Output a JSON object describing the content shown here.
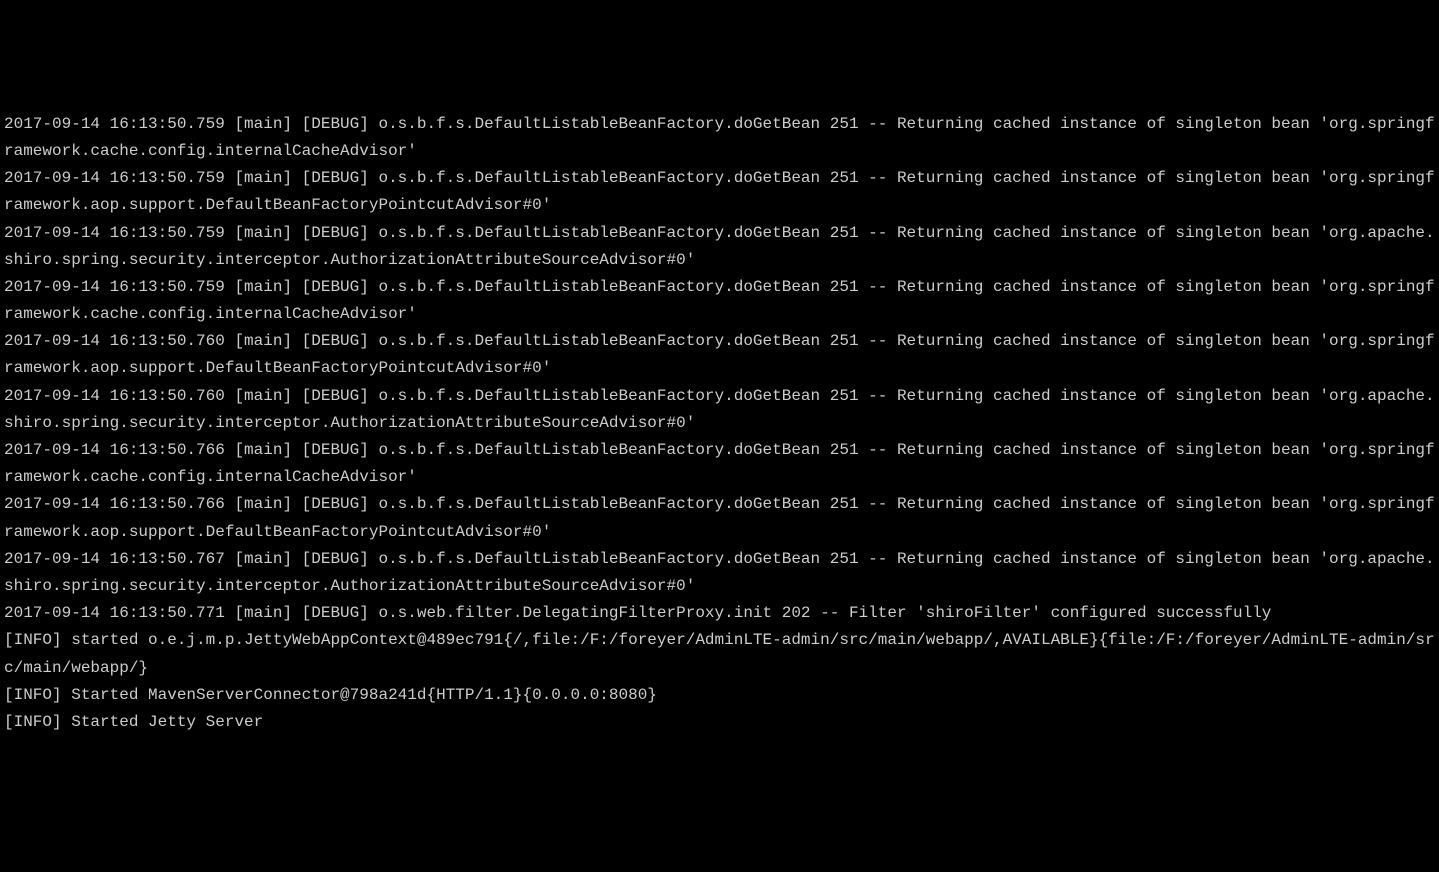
{
  "log_lines": [
    "2017-09-14 16:13:50.759 [main] [DEBUG] o.s.b.f.s.DefaultListableBeanFactory.doGetBean 251 -- Returning cached instance of singleton bean 'org.springframework.cache.config.internalCacheAdvisor'",
    "2017-09-14 16:13:50.759 [main] [DEBUG] o.s.b.f.s.DefaultListableBeanFactory.doGetBean 251 -- Returning cached instance of singleton bean 'org.springframework.aop.support.DefaultBeanFactoryPointcutAdvisor#0'",
    "2017-09-14 16:13:50.759 [main] [DEBUG] o.s.b.f.s.DefaultListableBeanFactory.doGetBean 251 -- Returning cached instance of singleton bean 'org.apache.shiro.spring.security.interceptor.AuthorizationAttributeSourceAdvisor#0'",
    "2017-09-14 16:13:50.759 [main] [DEBUG] o.s.b.f.s.DefaultListableBeanFactory.doGetBean 251 -- Returning cached instance of singleton bean 'org.springframework.cache.config.internalCacheAdvisor'",
    "2017-09-14 16:13:50.760 [main] [DEBUG] o.s.b.f.s.DefaultListableBeanFactory.doGetBean 251 -- Returning cached instance of singleton bean 'org.springframework.aop.support.DefaultBeanFactoryPointcutAdvisor#0'",
    "2017-09-14 16:13:50.760 [main] [DEBUG] o.s.b.f.s.DefaultListableBeanFactory.doGetBean 251 -- Returning cached instance of singleton bean 'org.apache.shiro.spring.security.interceptor.AuthorizationAttributeSourceAdvisor#0'",
    "2017-09-14 16:13:50.766 [main] [DEBUG] o.s.b.f.s.DefaultListableBeanFactory.doGetBean 251 -- Returning cached instance of singleton bean 'org.springframework.cache.config.internalCacheAdvisor'",
    "2017-09-14 16:13:50.766 [main] [DEBUG] o.s.b.f.s.DefaultListableBeanFactory.doGetBean 251 -- Returning cached instance of singleton bean 'org.springframework.aop.support.DefaultBeanFactoryPointcutAdvisor#0'",
    "2017-09-14 16:13:50.767 [main] [DEBUG] o.s.b.f.s.DefaultListableBeanFactory.doGetBean 251 -- Returning cached instance of singleton bean 'org.apache.shiro.spring.security.interceptor.AuthorizationAttributeSourceAdvisor#0'",
    "2017-09-14 16:13:50.771 [main] [DEBUG] o.s.web.filter.DelegatingFilterProxy.init 202 -- Filter 'shiroFilter' configured successfully",
    "[INFO] started o.e.j.m.p.JettyWebAppContext@489ec791{/,file:/F:/foreyer/AdminLTE-admin/src/main/webapp/,AVAILABLE}{file:/F:/foreyer/AdminLTE-admin/src/main/webapp/}",
    "[INFO] Started MavenServerConnector@798a241d{HTTP/1.1}{0.0.0.0:8080}",
    "[INFO] Started Jetty Server"
  ]
}
